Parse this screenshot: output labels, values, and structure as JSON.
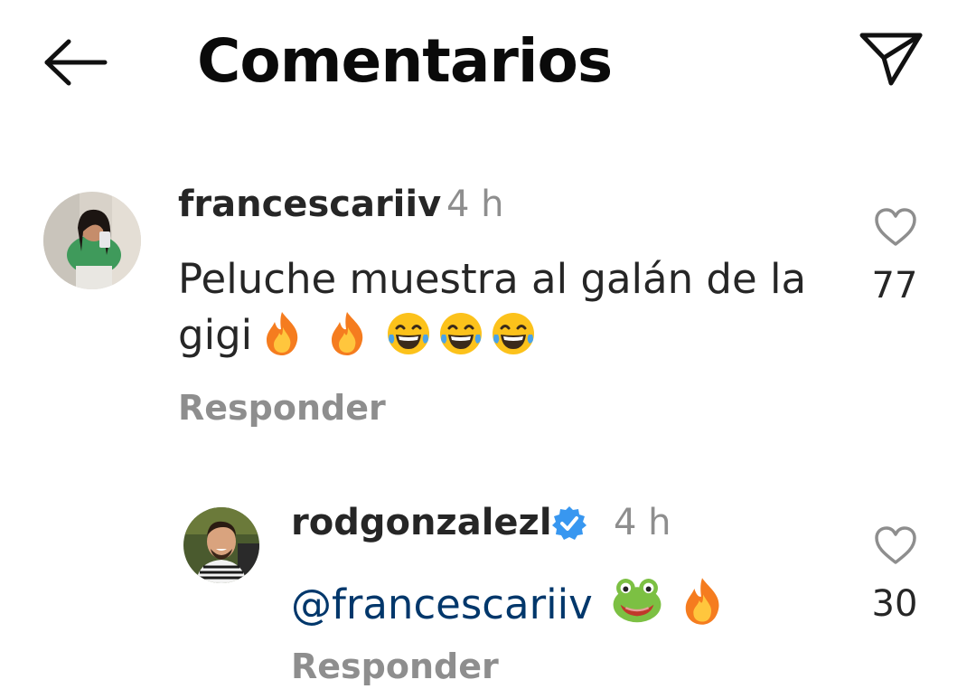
{
  "header": {
    "title": "Comentarios"
  },
  "comments": [
    {
      "username": "francescariiv",
      "time": "4 h",
      "text": "Peluche muestra al galán de la gigi",
      "emojis": [
        "fire",
        "fire",
        "joy",
        "joy",
        "joy"
      ],
      "reply_label": "Responder",
      "likes": "77"
    },
    {
      "username": "rodgonzalezl",
      "verified": true,
      "time": "4 h",
      "mention": "@francescariiv",
      "emojis": [
        "frog",
        "fire"
      ],
      "reply_label": "Responder",
      "likes": "30"
    }
  ],
  "icons": {
    "back": "arrow-left-icon",
    "share": "paper-plane-icon",
    "like": "heart-outline-icon",
    "verified": "verified-badge-icon"
  },
  "colors": {
    "text": "#262626",
    "secondary": "#8e8e8e",
    "mention": "#00376b",
    "verified": "#3897f0"
  }
}
